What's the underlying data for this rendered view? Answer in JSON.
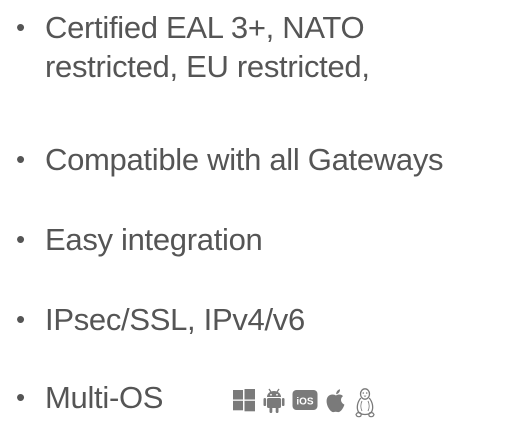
{
  "bullets": [
    {
      "line1": "Certified EAL 3+,  NATO",
      "line2": "restricted, EU restricted,"
    },
    {
      "line1": "Compatible with all Gateways"
    },
    {
      "line1": "Easy integration"
    },
    {
      "line1": "IPsec/SSL, IPv4/v6"
    },
    {
      "line1": "Multi-OS"
    }
  ],
  "bullet_glyph": "•",
  "os_icons": {
    "names": [
      "windows-icon",
      "android-icon",
      "ios-icon",
      "apple-icon",
      "linux-icon"
    ],
    "ios_label": "iOS"
  },
  "colors": {
    "text": "#555555",
    "icon": "#7a7a7a",
    "background": "#ffffff"
  }
}
